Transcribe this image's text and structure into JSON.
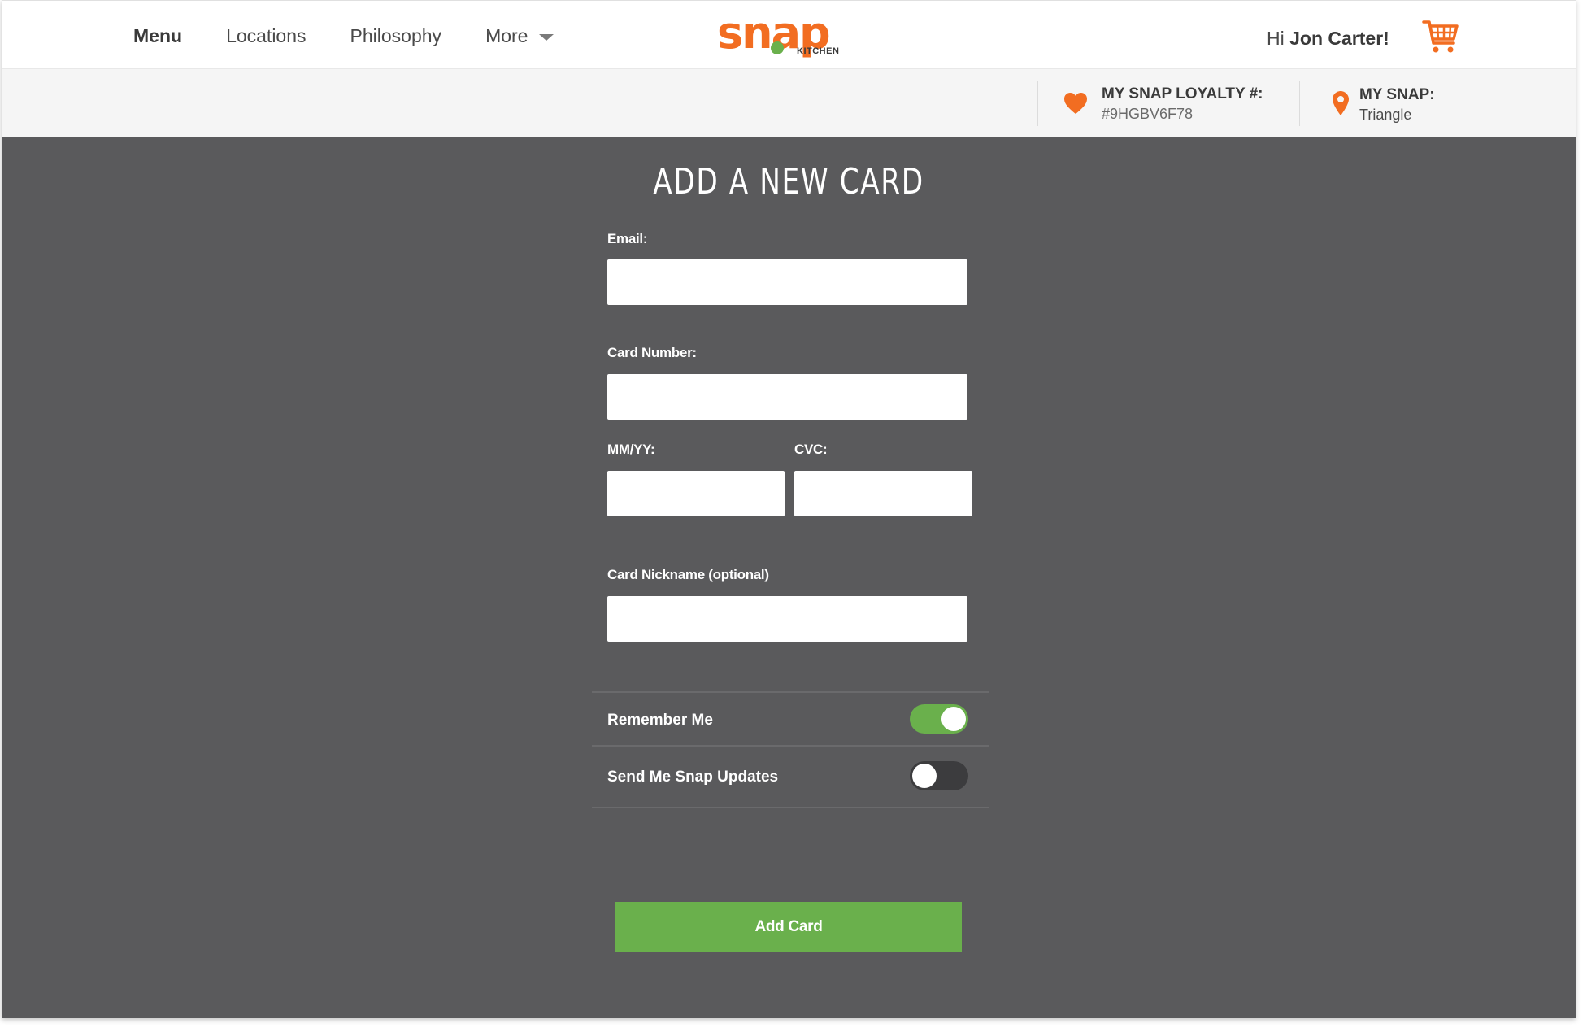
{
  "nav": {
    "items": [
      {
        "label": "Menu"
      },
      {
        "label": "Locations"
      },
      {
        "label": "Philosophy"
      },
      {
        "label": "More"
      }
    ]
  },
  "logo": {
    "main": "snap",
    "sub": "KITCHEN"
  },
  "user": {
    "greeting_prefix": "Hi ",
    "name": "Jon Carter!"
  },
  "loyalty": {
    "title": "MY SNAP LOYALTY #:",
    "value": "#9HGBV6F78"
  },
  "my_snap": {
    "title": "MY SNAP:",
    "value": "Triangle"
  },
  "form": {
    "title": "ADD A NEW CARD",
    "email_label": "Email:",
    "email_value": "",
    "card_number_label": "Card Number:",
    "card_number_value": "",
    "expiry_label": "MM/YY:",
    "expiry_value": "",
    "cvc_label": "CVC:",
    "cvc_value": "",
    "nickname_label": "Card Nickname (optional)",
    "nickname_value": "",
    "remember_me_label": "Remember Me",
    "remember_me_on": true,
    "updates_label": "Send Me Snap Updates",
    "updates_on": false,
    "submit_label": "Add Card"
  },
  "colors": {
    "brand_orange": "#f26d21",
    "accent_green": "#6ab04c",
    "background_gray": "#5a5a5c"
  },
  "icons": {
    "cart": "shopping-cart-icon",
    "loyalty": "heart-icon",
    "location": "map-pin-icon",
    "more": "chevron-down-icon"
  }
}
